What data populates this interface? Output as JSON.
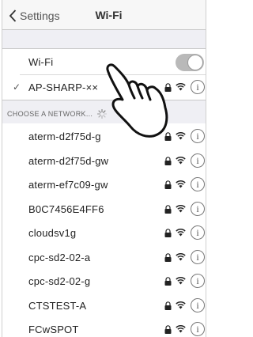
{
  "nav": {
    "back_label": "Settings",
    "title": "Wi-Fi"
  },
  "wifi_toggle": {
    "label": "Wi-Fi",
    "state": "on"
  },
  "connected_network": {
    "name": "AP-SHARP-××",
    "checked": true
  },
  "section": {
    "header": "CHOOSE A NETWORK..."
  },
  "networks": [
    {
      "name": "aterm-d2f75d-g"
    },
    {
      "name": "aterm-d2f75d-gw"
    },
    {
      "name": "aterm-ef7c09-gw"
    },
    {
      "name": "B0C7456E4FF6"
    },
    {
      "name": "cloudsv1g"
    },
    {
      "name": "cpc-sd2-02-a"
    },
    {
      "name": "cpc-sd2-02-g"
    },
    {
      "name": "CTSTEST-A"
    },
    {
      "name": "FCwSPOT"
    }
  ],
  "icons": {
    "back": "chevron-left-icon",
    "check": "checkmark-icon",
    "lock": "lock-icon",
    "wifi": "wifi-signal-icon",
    "info": "info-icon",
    "spinner": "loading-spinner-icon",
    "hand": "pointing-hand-icon"
  },
  "info_glyph": "i",
  "check_glyph": "✓"
}
